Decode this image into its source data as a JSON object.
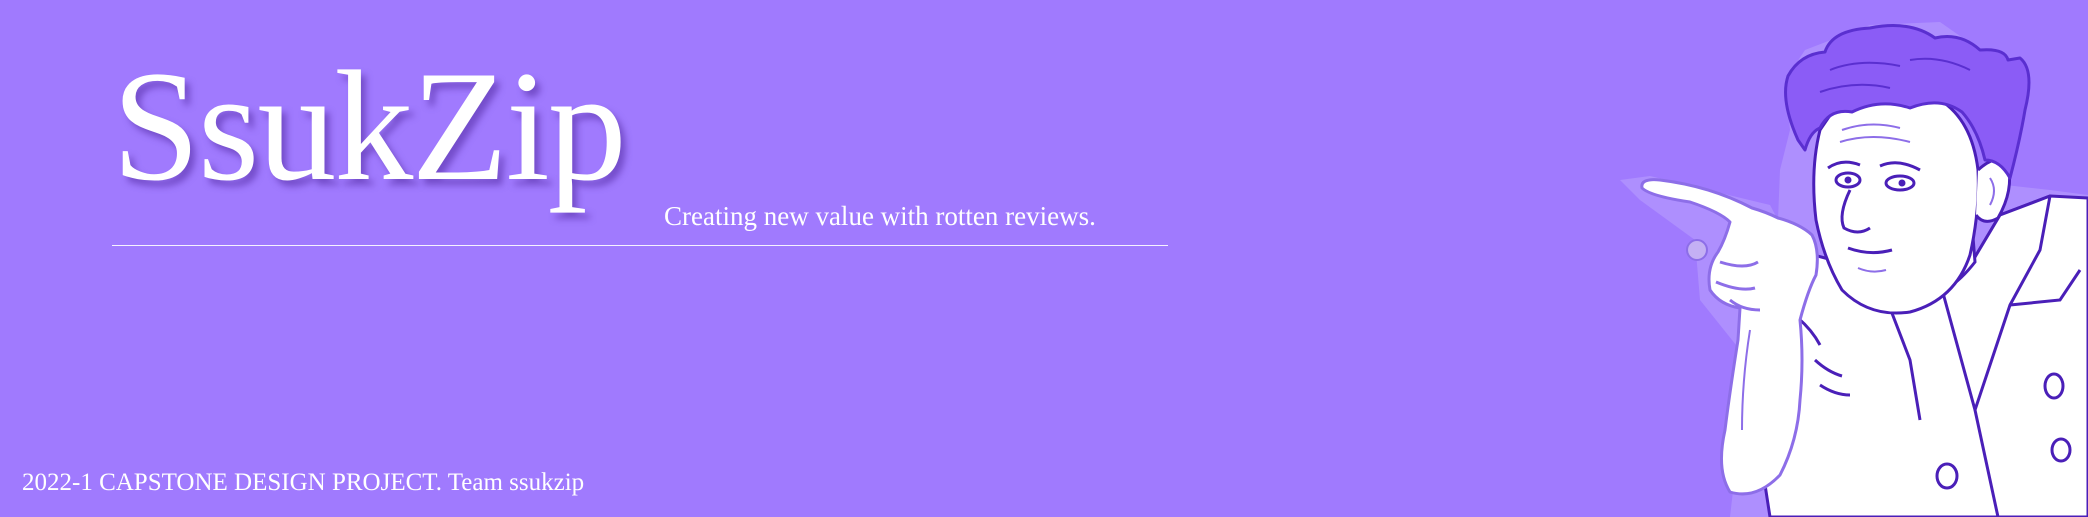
{
  "banner": {
    "title": "SsukZip",
    "subtitle": "Creating new value with rotten reviews.",
    "footer": "2022-1 CAPSTONE DESIGN PROJECT. Team ssukzip"
  },
  "illustration": {
    "icon": "pointing-man-illustration"
  },
  "colors": {
    "background": "#a07afe",
    "accent": "#8b5cf6",
    "outline": "#4a1fb8",
    "text": "#ffffff"
  }
}
